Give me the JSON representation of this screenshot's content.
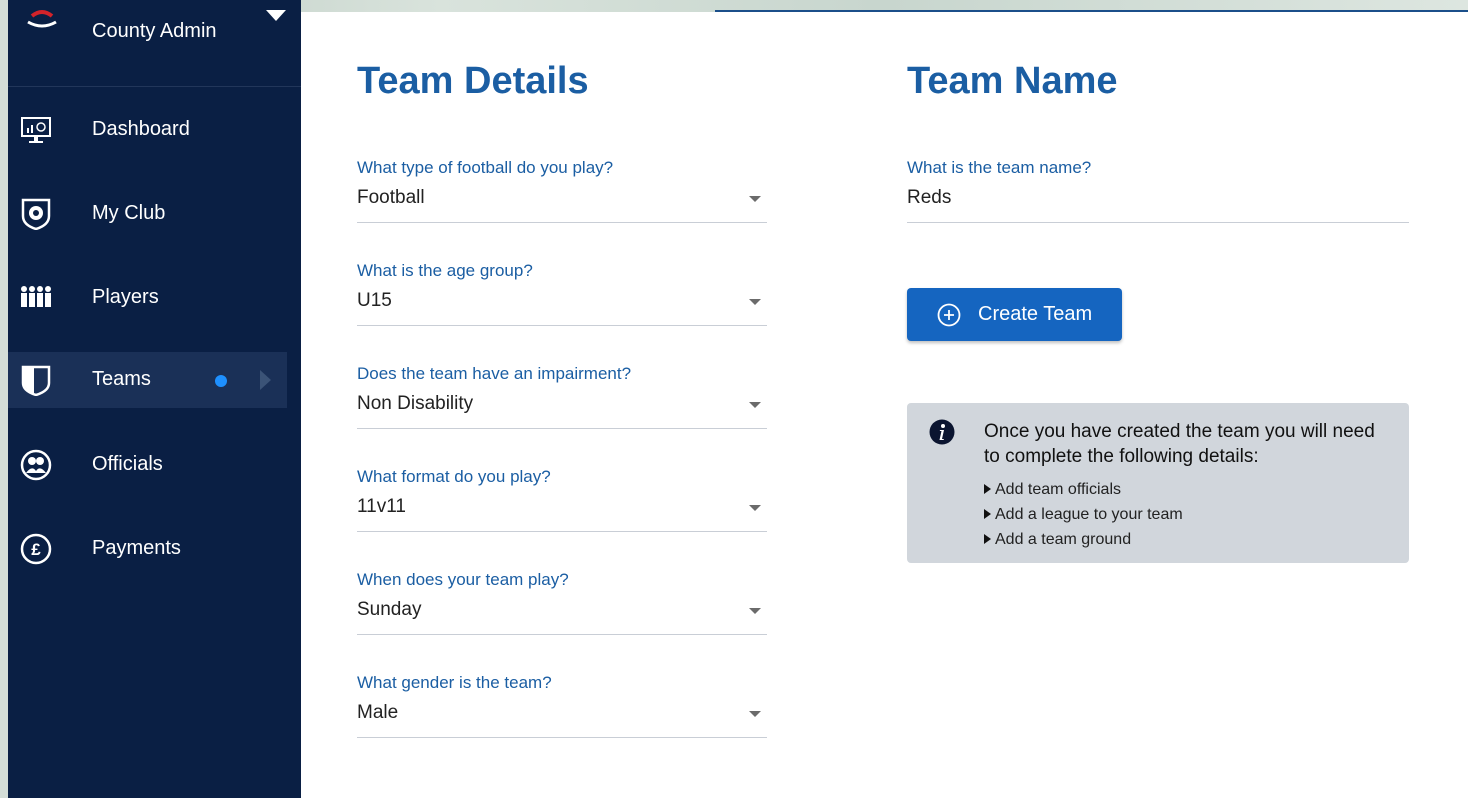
{
  "sidebar": {
    "user_role": "County Admin",
    "items": [
      {
        "label": "Dashboard",
        "icon": "dashboard-monitor-icon"
      },
      {
        "label": "My Club",
        "icon": "club-shield-icon"
      },
      {
        "label": "Players",
        "icon": "players-group-icon"
      },
      {
        "label": "Teams",
        "icon": "teams-shirt-icon",
        "active": true
      },
      {
        "label": "Officials",
        "icon": "officials-icon"
      },
      {
        "label": "Payments",
        "icon": "pound-coin-icon"
      }
    ]
  },
  "team_details": {
    "title": "Team Details",
    "fields": [
      {
        "question": "What type of football do you play?",
        "value": "Football"
      },
      {
        "question": "What is the age group?",
        "value": "U15"
      },
      {
        "question": "Does the team have an impairment?",
        "value": "Non Disability"
      },
      {
        "question": "What format do you play?",
        "value": "11v11"
      },
      {
        "question": "When does your team play?",
        "value": "Sunday"
      },
      {
        "question": "What gender is the team?",
        "value": "Male"
      }
    ]
  },
  "team_name": {
    "title": "Team Name",
    "question": "What is the team name?",
    "value": "Reds"
  },
  "create_button": {
    "label": "Create Team"
  },
  "info_box": {
    "message": "Once you have created the team you will need to complete the following details:",
    "items": [
      "Add team officials",
      "Add a league to your team",
      "Add a team ground"
    ]
  },
  "colors": {
    "sidebar": "#0a1f44",
    "accent": "#1b5ea3",
    "button": "#1565c0",
    "dot": "#1e90ff"
  }
}
